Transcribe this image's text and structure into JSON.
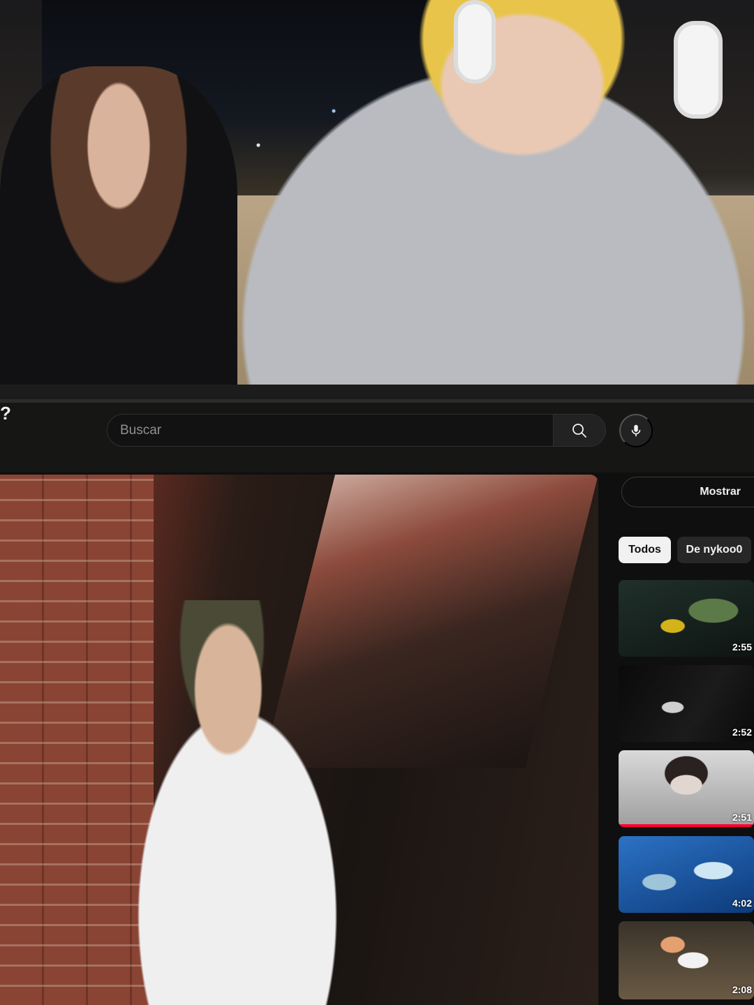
{
  "stream": {
    "username": "nykoo0"
  },
  "header": {
    "question_mark": "?",
    "search": {
      "placeholder": "Buscar",
      "value": ""
    }
  },
  "sidebar": {
    "show_button_label": "Mostrar",
    "chips": [
      {
        "label": "Todos",
        "selected": true
      },
      {
        "label": "De nykoo0",
        "selected": false
      }
    ],
    "recommended_videos": [
      {
        "duration": "2:55"
      },
      {
        "duration": "2:52"
      },
      {
        "duration": "2:51",
        "watched_progress": 1.0
      },
      {
        "duration": "4:02"
      },
      {
        "duration": "2:08"
      }
    ]
  },
  "colors": {
    "background": "#0f0f0f",
    "chip_selected": "#f1f1f1",
    "chip_default": "#272727",
    "progress_red": "#ff0033"
  },
  "icons": [
    "search-icon",
    "microphone-icon"
  ]
}
